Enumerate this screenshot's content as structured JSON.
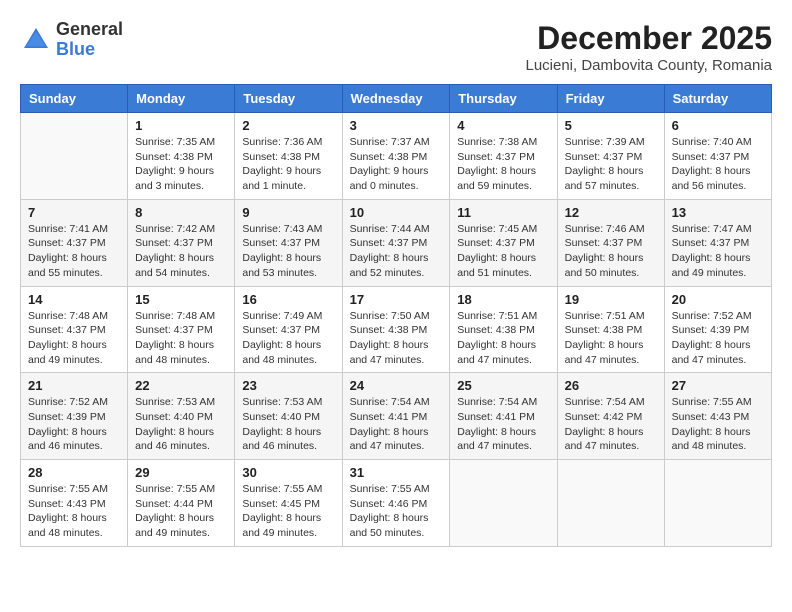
{
  "logo": {
    "general": "General",
    "blue": "Blue"
  },
  "title": "December 2025",
  "subtitle": "Lucieni, Dambovita County, Romania",
  "weekdays": [
    "Sunday",
    "Monday",
    "Tuesday",
    "Wednesday",
    "Thursday",
    "Friday",
    "Saturday"
  ],
  "weeks": [
    [
      {
        "day": "",
        "info": ""
      },
      {
        "day": "1",
        "info": "Sunrise: 7:35 AM\nSunset: 4:38 PM\nDaylight: 9 hours\nand 3 minutes."
      },
      {
        "day": "2",
        "info": "Sunrise: 7:36 AM\nSunset: 4:38 PM\nDaylight: 9 hours\nand 1 minute."
      },
      {
        "day": "3",
        "info": "Sunrise: 7:37 AM\nSunset: 4:38 PM\nDaylight: 9 hours\nand 0 minutes."
      },
      {
        "day": "4",
        "info": "Sunrise: 7:38 AM\nSunset: 4:37 PM\nDaylight: 8 hours\nand 59 minutes."
      },
      {
        "day": "5",
        "info": "Sunrise: 7:39 AM\nSunset: 4:37 PM\nDaylight: 8 hours\nand 57 minutes."
      },
      {
        "day": "6",
        "info": "Sunrise: 7:40 AM\nSunset: 4:37 PM\nDaylight: 8 hours\nand 56 minutes."
      }
    ],
    [
      {
        "day": "7",
        "info": "Sunrise: 7:41 AM\nSunset: 4:37 PM\nDaylight: 8 hours\nand 55 minutes."
      },
      {
        "day": "8",
        "info": "Sunrise: 7:42 AM\nSunset: 4:37 PM\nDaylight: 8 hours\nand 54 minutes."
      },
      {
        "day": "9",
        "info": "Sunrise: 7:43 AM\nSunset: 4:37 PM\nDaylight: 8 hours\nand 53 minutes."
      },
      {
        "day": "10",
        "info": "Sunrise: 7:44 AM\nSunset: 4:37 PM\nDaylight: 8 hours\nand 52 minutes."
      },
      {
        "day": "11",
        "info": "Sunrise: 7:45 AM\nSunset: 4:37 PM\nDaylight: 8 hours\nand 51 minutes."
      },
      {
        "day": "12",
        "info": "Sunrise: 7:46 AM\nSunset: 4:37 PM\nDaylight: 8 hours\nand 50 minutes."
      },
      {
        "day": "13",
        "info": "Sunrise: 7:47 AM\nSunset: 4:37 PM\nDaylight: 8 hours\nand 49 minutes."
      }
    ],
    [
      {
        "day": "14",
        "info": "Sunrise: 7:48 AM\nSunset: 4:37 PM\nDaylight: 8 hours\nand 49 minutes."
      },
      {
        "day": "15",
        "info": "Sunrise: 7:48 AM\nSunset: 4:37 PM\nDaylight: 8 hours\nand 48 minutes."
      },
      {
        "day": "16",
        "info": "Sunrise: 7:49 AM\nSunset: 4:37 PM\nDaylight: 8 hours\nand 48 minutes."
      },
      {
        "day": "17",
        "info": "Sunrise: 7:50 AM\nSunset: 4:38 PM\nDaylight: 8 hours\nand 47 minutes."
      },
      {
        "day": "18",
        "info": "Sunrise: 7:51 AM\nSunset: 4:38 PM\nDaylight: 8 hours\nand 47 minutes."
      },
      {
        "day": "19",
        "info": "Sunrise: 7:51 AM\nSunset: 4:38 PM\nDaylight: 8 hours\nand 47 minutes."
      },
      {
        "day": "20",
        "info": "Sunrise: 7:52 AM\nSunset: 4:39 PM\nDaylight: 8 hours\nand 47 minutes."
      }
    ],
    [
      {
        "day": "21",
        "info": "Sunrise: 7:52 AM\nSunset: 4:39 PM\nDaylight: 8 hours\nand 46 minutes."
      },
      {
        "day": "22",
        "info": "Sunrise: 7:53 AM\nSunset: 4:40 PM\nDaylight: 8 hours\nand 46 minutes."
      },
      {
        "day": "23",
        "info": "Sunrise: 7:53 AM\nSunset: 4:40 PM\nDaylight: 8 hours\nand 46 minutes."
      },
      {
        "day": "24",
        "info": "Sunrise: 7:54 AM\nSunset: 4:41 PM\nDaylight: 8 hours\nand 47 minutes."
      },
      {
        "day": "25",
        "info": "Sunrise: 7:54 AM\nSunset: 4:41 PM\nDaylight: 8 hours\nand 47 minutes."
      },
      {
        "day": "26",
        "info": "Sunrise: 7:54 AM\nSunset: 4:42 PM\nDaylight: 8 hours\nand 47 minutes."
      },
      {
        "day": "27",
        "info": "Sunrise: 7:55 AM\nSunset: 4:43 PM\nDaylight: 8 hours\nand 48 minutes."
      }
    ],
    [
      {
        "day": "28",
        "info": "Sunrise: 7:55 AM\nSunset: 4:43 PM\nDaylight: 8 hours\nand 48 minutes."
      },
      {
        "day": "29",
        "info": "Sunrise: 7:55 AM\nSunset: 4:44 PM\nDaylight: 8 hours\nand 49 minutes."
      },
      {
        "day": "30",
        "info": "Sunrise: 7:55 AM\nSunset: 4:45 PM\nDaylight: 8 hours\nand 49 minutes."
      },
      {
        "day": "31",
        "info": "Sunrise: 7:55 AM\nSunset: 4:46 PM\nDaylight: 8 hours\nand 50 minutes."
      },
      {
        "day": "",
        "info": ""
      },
      {
        "day": "",
        "info": ""
      },
      {
        "day": "",
        "info": ""
      }
    ]
  ]
}
